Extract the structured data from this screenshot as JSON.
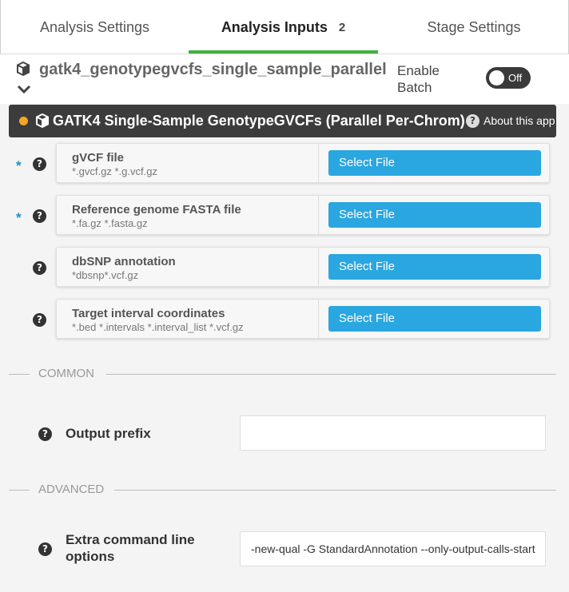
{
  "tabs": [
    {
      "label": "Analysis Settings"
    },
    {
      "label": "Analysis Inputs",
      "badge": "2"
    },
    {
      "label": "Stage Settings"
    }
  ],
  "colors": {
    "active_tab": "#3db33d",
    "button": "#2aa6e0",
    "status_dot": "#f5a623",
    "required": "#1b8fc8"
  },
  "header": {
    "title": "gatk4_genotypegvcfs_single_sample_parallel",
    "enable_batch_line1": "Enable",
    "enable_batch_line2": "Batch",
    "toggle_label": "Off"
  },
  "app": {
    "title": "GATK4 Single-Sample GenotypeGVCFs (Parallel Per-Chrom)",
    "about_label": "About this app"
  },
  "inputs": [
    {
      "label": "gVCF file",
      "patterns": "*.gvcf.gz *.g.vcf.gz",
      "required": true,
      "button": "Select File"
    },
    {
      "label": "Reference genome FASTA file",
      "patterns": "*.fa.gz *.fasta.gz",
      "required": true,
      "button": "Select File"
    },
    {
      "label": "dbSNP annotation",
      "patterns": "*dbsnp*.vcf.gz",
      "required": false,
      "button": "Select File"
    },
    {
      "label": "Target interval coordinates",
      "patterns": "*.bed *.intervals *.interval_list *.vcf.gz",
      "required": false,
      "button": "Select File"
    }
  ],
  "required_marker": "*",
  "common": {
    "heading": "COMMON",
    "output_prefix_label": "Output prefix",
    "output_prefix_value": ""
  },
  "advanced": {
    "heading": "ADVANCED",
    "extra_label_line1": "Extra command line",
    "extra_label_line2": "options",
    "extra_value": "-new-qual -G StandardAnnotation --only-output-calls-starting-in-intervals"
  },
  "icons": {
    "help": "?",
    "cube": "cube-icon",
    "chevron": "chevron-down-icon"
  }
}
